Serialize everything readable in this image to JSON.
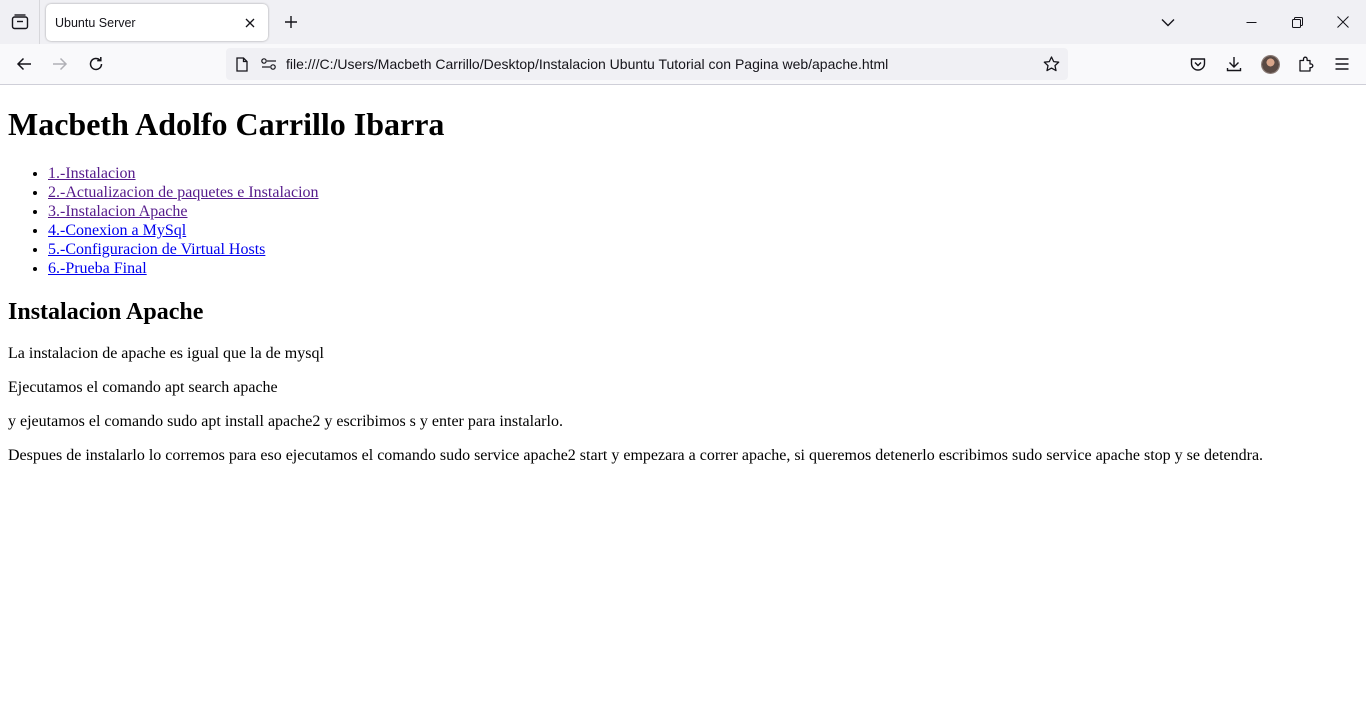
{
  "browser": {
    "tab": {
      "title": "Ubuntu Server"
    },
    "url": "file:///C:/Users/Macbeth Carrillo/Desktop/Instalacion Ubuntu Tutorial con Pagina web/apache.html",
    "icons": {
      "tab_list": "tab-list-icon",
      "new_tab": "plus-icon",
      "back": "arrow-left-icon",
      "forward": "arrow-right-icon",
      "reload": "reload-icon",
      "bookmark": "star-icon",
      "pocket": "pocket-icon",
      "downloads": "download-icon",
      "extensions": "puzzle-icon",
      "menu": "hamburger-icon"
    }
  },
  "page": {
    "heading": "Macbeth Adolfo Carrillo Ibarra",
    "nav_links": [
      {
        "label": "1.-Instalacion",
        "visited": true
      },
      {
        "label": "2.-Actualizacion de paquetes e Instalacion",
        "visited": true
      },
      {
        "label": "3.-Instalacion Apache",
        "visited": true
      },
      {
        "label": "4.-Conexion a MySql",
        "visited": false
      },
      {
        "label": "5.-Configuracion de Virtual Hosts",
        "visited": false
      },
      {
        "label": "6.-Prueba Final",
        "visited": false
      }
    ],
    "section_title": "Instalacion Apache",
    "paragraphs": [
      "La instalacion de apache es igual que la de mysql",
      "Ejecutamos el comando apt search apache",
      "y ejeutamos el comando sudo apt install apache2 y escribimos s y enter para instalarlo.",
      "Despues de instalarlo lo corremos para eso ejecutamos el comando sudo service apache2 start y empezara a correr apache, si queremos detenerlo escribimos sudo service apache stop y se detendra."
    ],
    "colors": {
      "link": "#0000ee",
      "visited_link": "#551a8b"
    }
  }
}
